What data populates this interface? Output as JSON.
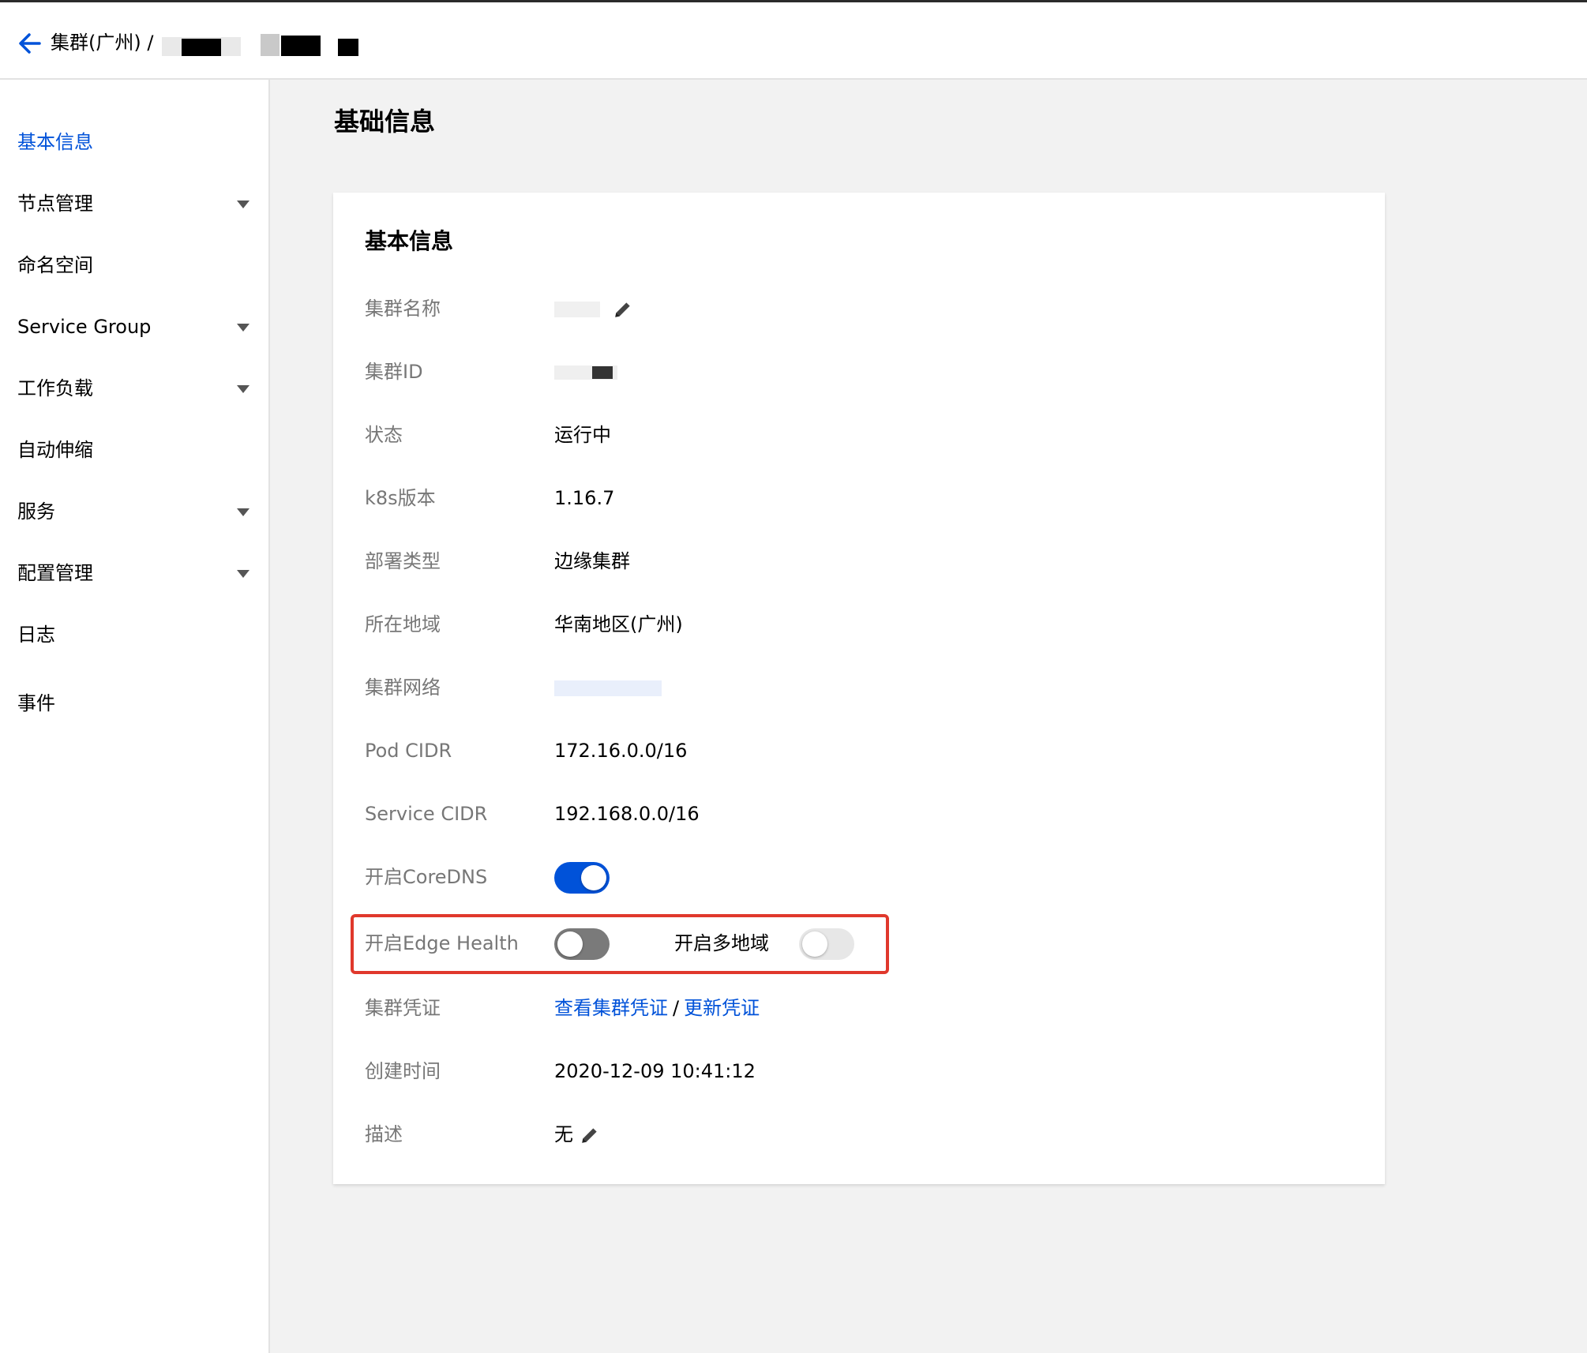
{
  "header": {
    "back_icon": "arrow-left-icon",
    "breadcrumb_text": "集群(广州) /",
    "accent_color": "#0052d9"
  },
  "sidebar": {
    "items": [
      {
        "label": "基本信息",
        "active": true,
        "has_caret": false
      },
      {
        "label": "节点管理",
        "active": false,
        "has_caret": true
      },
      {
        "label": "命名空间",
        "active": false,
        "has_caret": false
      },
      {
        "label": "Service Group",
        "active": false,
        "has_caret": true
      },
      {
        "label": "工作负载",
        "active": false,
        "has_caret": true
      },
      {
        "label": "自动伸缩",
        "active": false,
        "has_caret": false
      },
      {
        "label": "服务",
        "active": false,
        "has_caret": true
      },
      {
        "label": "配置管理",
        "active": false,
        "has_caret": true
      },
      {
        "label": "日志",
        "active": false,
        "has_caret": false
      },
      {
        "label": "事件",
        "active": false,
        "has_caret": false
      }
    ]
  },
  "page": {
    "title": "基础信息"
  },
  "card": {
    "title": "基本信息",
    "rows": {
      "cluster_name": {
        "label": "集群名称",
        "icon": "pencil-icon"
      },
      "cluster_id": {
        "label": "集群ID"
      },
      "status": {
        "label": "状态",
        "value": "运行中"
      },
      "k8s_version": {
        "label": "k8s版本",
        "value": "1.16.7"
      },
      "deploy_type": {
        "label": "部署类型",
        "value": "边缘集群"
      },
      "region": {
        "label": "所在地域",
        "value": "华南地区(广州)"
      },
      "network": {
        "label": "集群网络"
      },
      "pod_cidr": {
        "label": "Pod CIDR",
        "value": "172.16.0.0/16"
      },
      "service_cidr": {
        "label": "Service CIDR",
        "value": "192.168.0.0/16"
      },
      "coredns": {
        "label": "开启CoreDNS",
        "enabled": true
      },
      "edge_health": {
        "label": "开启Edge Health",
        "enabled": false
      },
      "multi_region": {
        "label": "开启多地域",
        "enabled": false
      },
      "credentials": {
        "label": "集群凭证",
        "view_link": "查看集群凭证",
        "separator": "/",
        "update_link": "更新凭证"
      },
      "created_at": {
        "label": "创建时间",
        "value": "2020-12-09 10:41:12"
      },
      "description": {
        "label": "描述",
        "value": "无",
        "icon": "pencil-icon"
      }
    }
  },
  "highlight_color": "#e0382c"
}
